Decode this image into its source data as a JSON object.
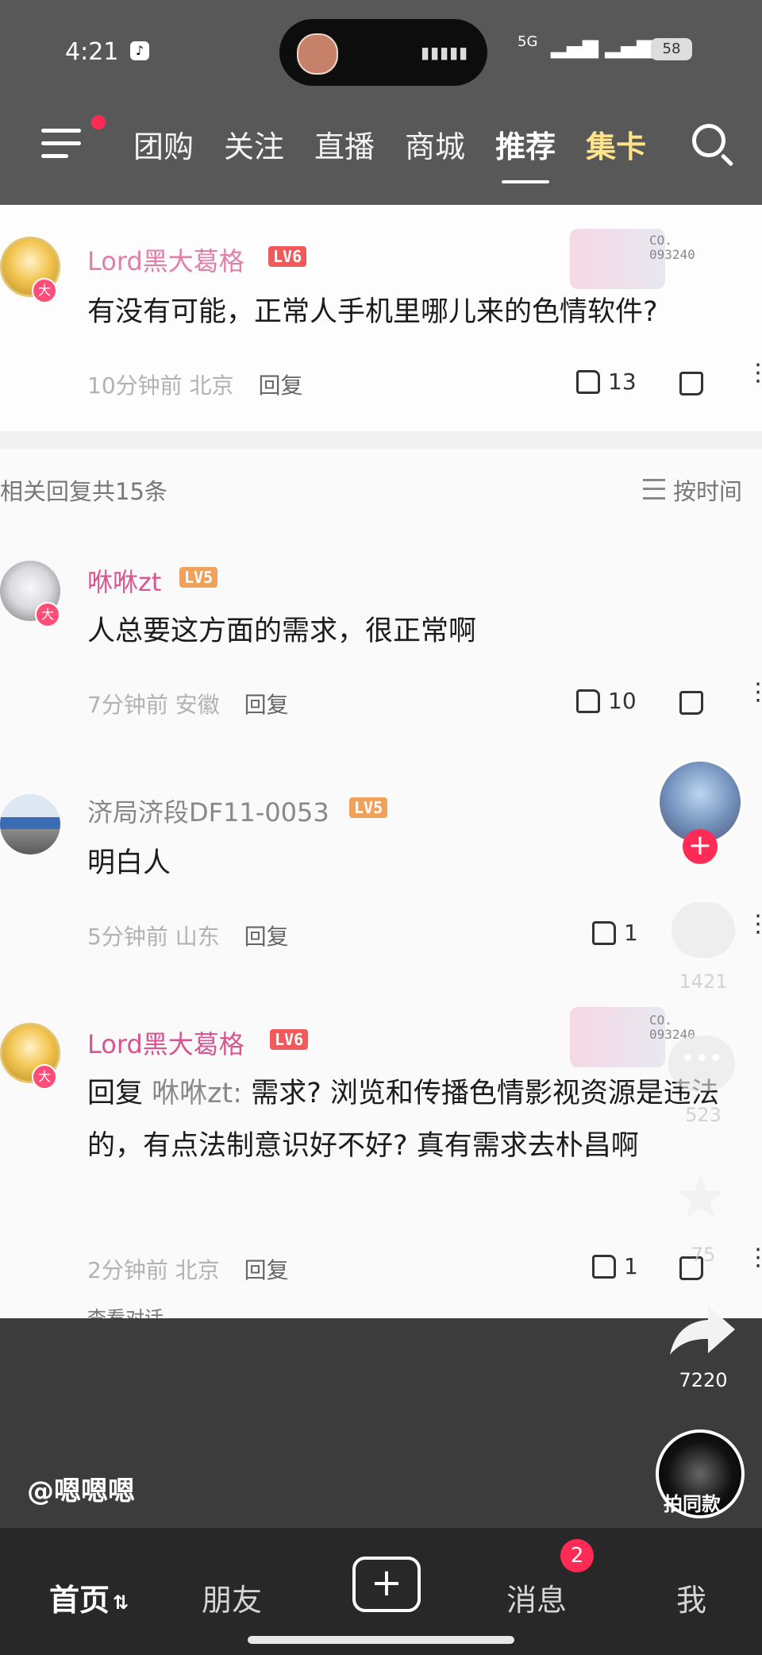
{
  "status_bar": {
    "time": "4:21",
    "signal": "5G",
    "battery": "58"
  },
  "nav": {
    "tabs": [
      {
        "label": "团购"
      },
      {
        "label": "关注"
      },
      {
        "label": "直播"
      },
      {
        "label": "商城"
      },
      {
        "label": "推荐"
      },
      {
        "label": "集卡"
      }
    ]
  },
  "comments": {
    "top": {
      "user": "Lord黑大葛格",
      "level": "LV6",
      "text": "有没有可能，正常人手机里哪儿来的色情软件?",
      "time": "10分钟前",
      "location": "北京",
      "reply_label": "回复",
      "likes": "13",
      "badge_code": "CO.\n093240"
    },
    "replies_count": "相关回复共15条",
    "sort_label": "按时间",
    "list": [
      {
        "user": "咻咻zt",
        "level": "LV5",
        "text": "人总要这方面的需求，很正常啊",
        "time": "7分钟前",
        "location": "安徽",
        "reply_label": "回复",
        "likes": "10"
      },
      {
        "user": "济局济段DF11-0053",
        "level": "LV5",
        "text": "明白人",
        "time": "5分钟前",
        "location": "山东",
        "reply_label": "回复",
        "likes": "1"
      },
      {
        "user": "Lord黑大葛格",
        "level": "LV6",
        "reply_prefix": "回复",
        "reply_to": "咻咻zt:",
        "text": "需求? 浏览和传播色情影视资源是违法的，有点法制意识好不好? 真有需求去朴昌啊",
        "time": "2分钟前",
        "location": "北京",
        "reply_label": "回复",
        "likes": "1",
        "badge_code": "CO.\n093240"
      }
    ],
    "cut_text": "查看对话"
  },
  "rail": {
    "like_count": "1421",
    "comment_count": "523",
    "favorite_count": "75",
    "share_count": "7220",
    "music_label": "拍同款"
  },
  "video": {
    "author": "@嗯嗯嗯"
  },
  "bottom_nav": {
    "home": "首页",
    "friends": "朋友",
    "messages": "消息",
    "messages_badge": "2",
    "me": "我"
  }
}
